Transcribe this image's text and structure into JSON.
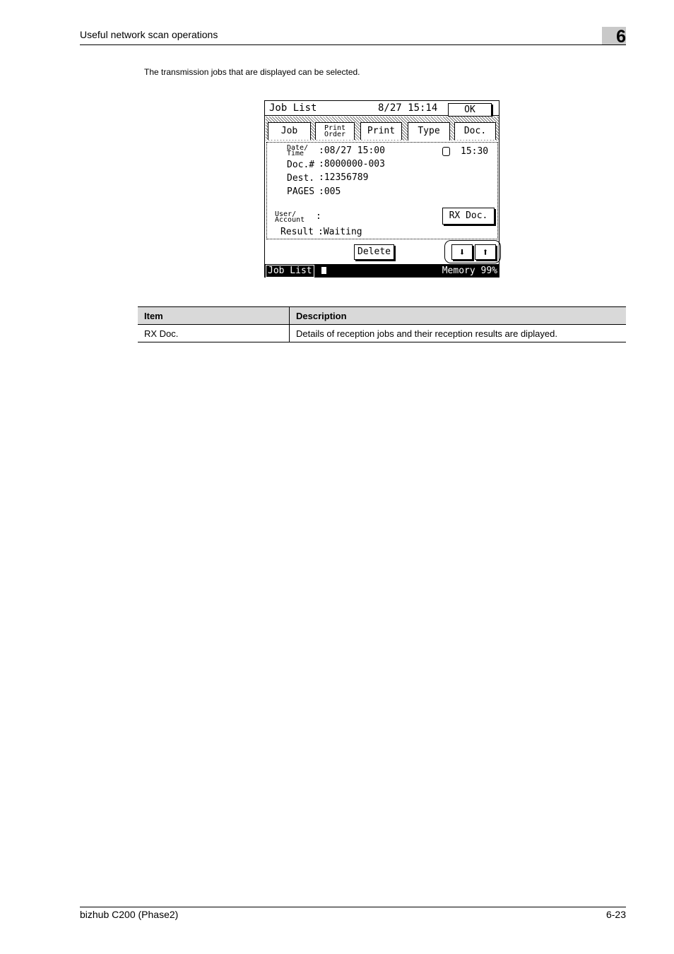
{
  "header": {
    "section_title": "Useful network scan operations",
    "chapter_number": "6"
  },
  "intro_text": "The transmission jobs that are displayed can be selected.",
  "screen": {
    "title": "Job List",
    "datetime": "8/27 15:14",
    "ok_label": "OK",
    "tabs": [
      "Job",
      "Print Order",
      "Print",
      "Type",
      "Doc."
    ],
    "tab_print_order_lines": [
      "Print",
      "Order"
    ],
    "fields": {
      "date_time_label_lines": [
        "Date/",
        "Time"
      ],
      "date_time_value": ":08/27 15:00",
      "clock_value": "15:30",
      "doc_label": "Doc.#",
      "doc_value": ":8000000-003",
      "dest_label": "Dest.",
      "dest_value": ":12356789",
      "pages_label": "PAGES",
      "pages_value": ":005",
      "user_label_lines": [
        "User/",
        "Account"
      ],
      "user_value": ":",
      "result_label": "Result",
      "result_value": ":Waiting"
    },
    "rx_doc_label": "RX Doc.",
    "delete_label": "Delete",
    "arrow_down": "⬇",
    "arrow_up": "⬆",
    "status_left": "Job List",
    "status_right": "Memory 99%"
  },
  "table": {
    "headers": [
      "Item",
      "Description"
    ],
    "rows": [
      [
        "RX Doc.",
        "Details of reception jobs and their reception results are diplayed."
      ]
    ]
  },
  "footer": {
    "left": "bizhub C200 (Phase2)",
    "right": "6-23"
  }
}
